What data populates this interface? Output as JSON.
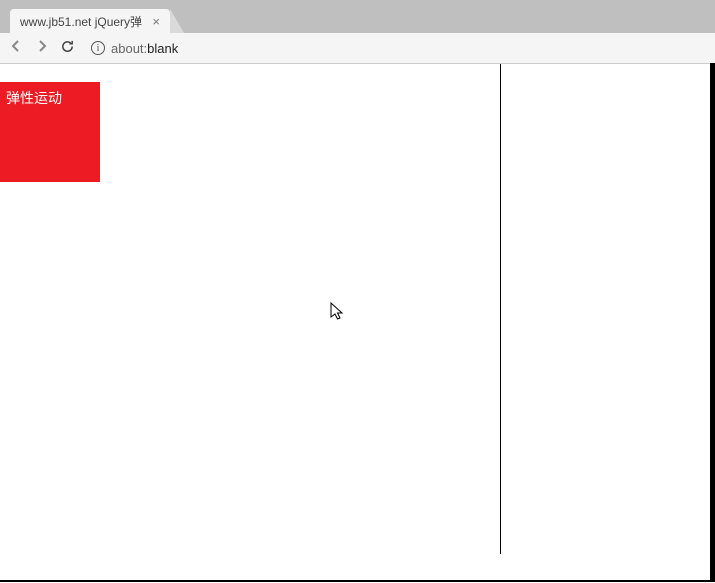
{
  "browser": {
    "tab": {
      "title": "www.jb51.net jQuery弹",
      "close_symbol": "×"
    },
    "address": {
      "protocol": "about:",
      "path": "blank"
    }
  },
  "page": {
    "red_box_text": "弹性运动"
  }
}
